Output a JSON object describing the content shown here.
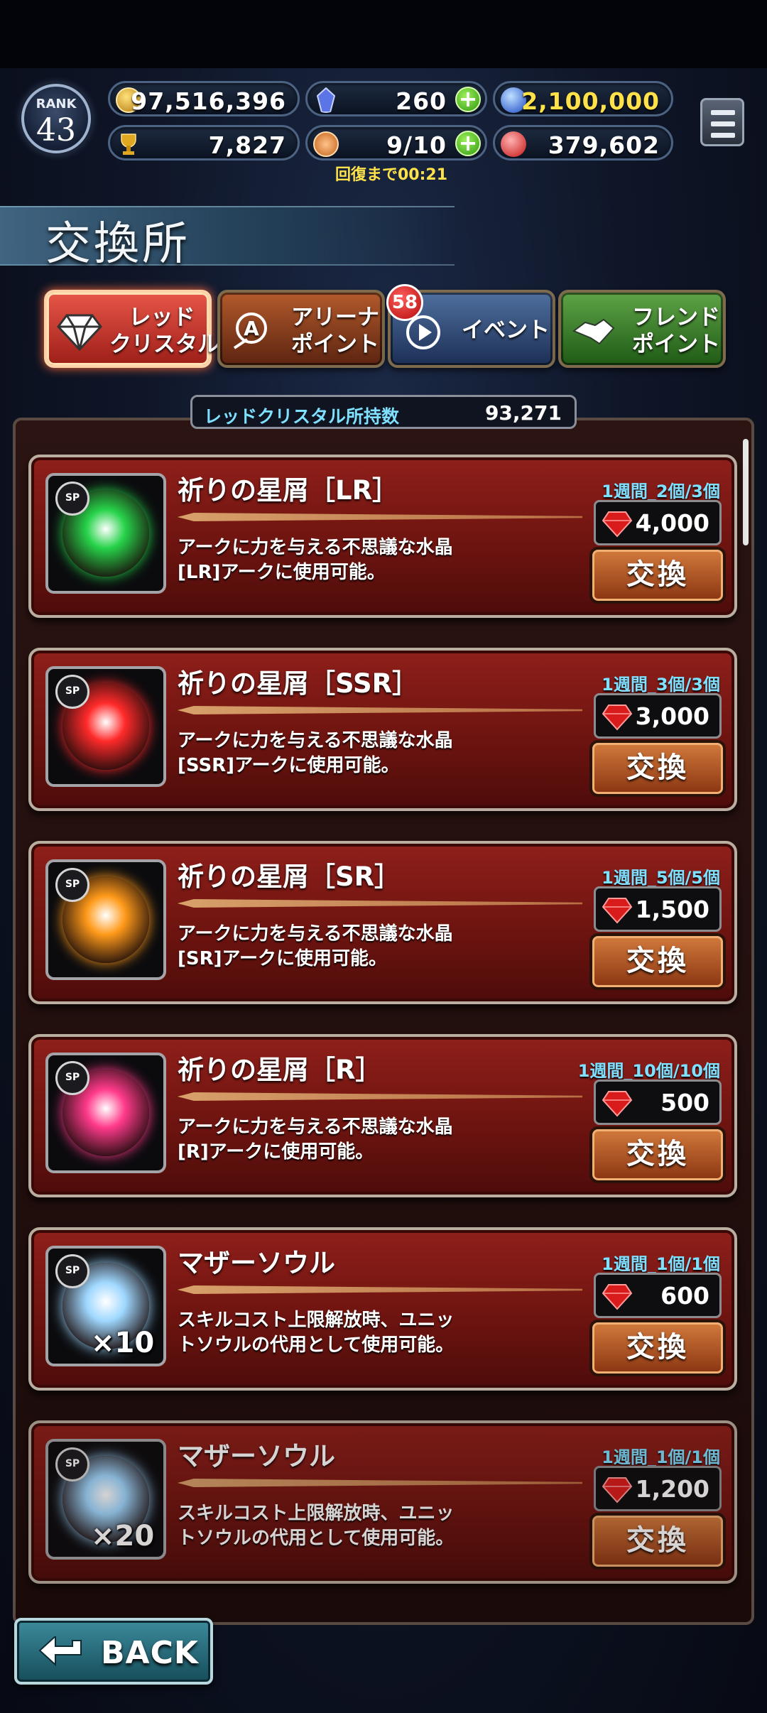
{
  "header": {
    "rank_label": "RANK",
    "rank_value": "43",
    "gold": "97,516,396",
    "crystal": "260",
    "blue_points": "2,100,000",
    "trophy": "7,827",
    "stamina": "9/10",
    "red_points": "379,602",
    "recovery_text": "回復まで00:21"
  },
  "title": "交換所",
  "tabs": [
    {
      "label": "レッド\nクリスタル",
      "selected": true
    },
    {
      "label": "アリーナ\nポイント",
      "selected": false
    },
    {
      "label": "イベント",
      "selected": false,
      "badge": "58"
    },
    {
      "label": "フレンド\nポイント",
      "selected": false
    }
  ],
  "holdings": {
    "label": "レッドクリスタル所持数",
    "value": "93,271"
  },
  "items": [
    {
      "name": "祈りの星屑［LR］",
      "desc": "アークに力を与える不思議な水晶\n[LR]アークに使用可能。",
      "limit": "1週間_2個/3個",
      "price": "4,000",
      "button": "交換",
      "orb_color": "#27d34a",
      "qty": ""
    },
    {
      "name": "祈りの星屑［SSR］",
      "desc": "アークに力を与える不思議な水晶\n[SSR]アークに使用可能。",
      "limit": "1週間_3個/3個",
      "price": "3,000",
      "button": "交換",
      "orb_color": "#ff2a2a",
      "qty": ""
    },
    {
      "name": "祈りの星屑［SR］",
      "desc": "アークに力を与える不思議な水晶\n[SR]アークに使用可能。",
      "limit": "1週間_5個/5個",
      "price": "1,500",
      "button": "交換",
      "orb_color": "#ff9a1a",
      "qty": ""
    },
    {
      "name": "祈りの星屑［R］",
      "desc": "アークに力を与える不思議な水晶\n[R]アークに使用可能。",
      "limit": "1週間_10個/10個",
      "price": "500",
      "button": "交換",
      "orb_color": "#ff3a8a",
      "qty": ""
    },
    {
      "name": "マザーソウル",
      "desc": "スキルコスト上限解放時、ユニッ\nトソウルの代用として使用可能。",
      "limit": "1週間_1個/1個",
      "price": "600",
      "button": "交換",
      "orb_color": "#9fd8ff",
      "qty": "×10"
    },
    {
      "name": "マザーソウル",
      "desc": "スキルコスト上限解放時、ユニッ\nトソウルの代用として使用可能。",
      "limit": "1週間_1個/1個",
      "price": "1,200",
      "button": "交換",
      "orb_color": "#9fd8ff",
      "qty": "×20"
    }
  ],
  "back_label": "BACK",
  "colors": {
    "accent_cyan": "#7fe0ff",
    "recovery_yellow": "#ffe14a",
    "card_red": "#8f1f1a"
  }
}
